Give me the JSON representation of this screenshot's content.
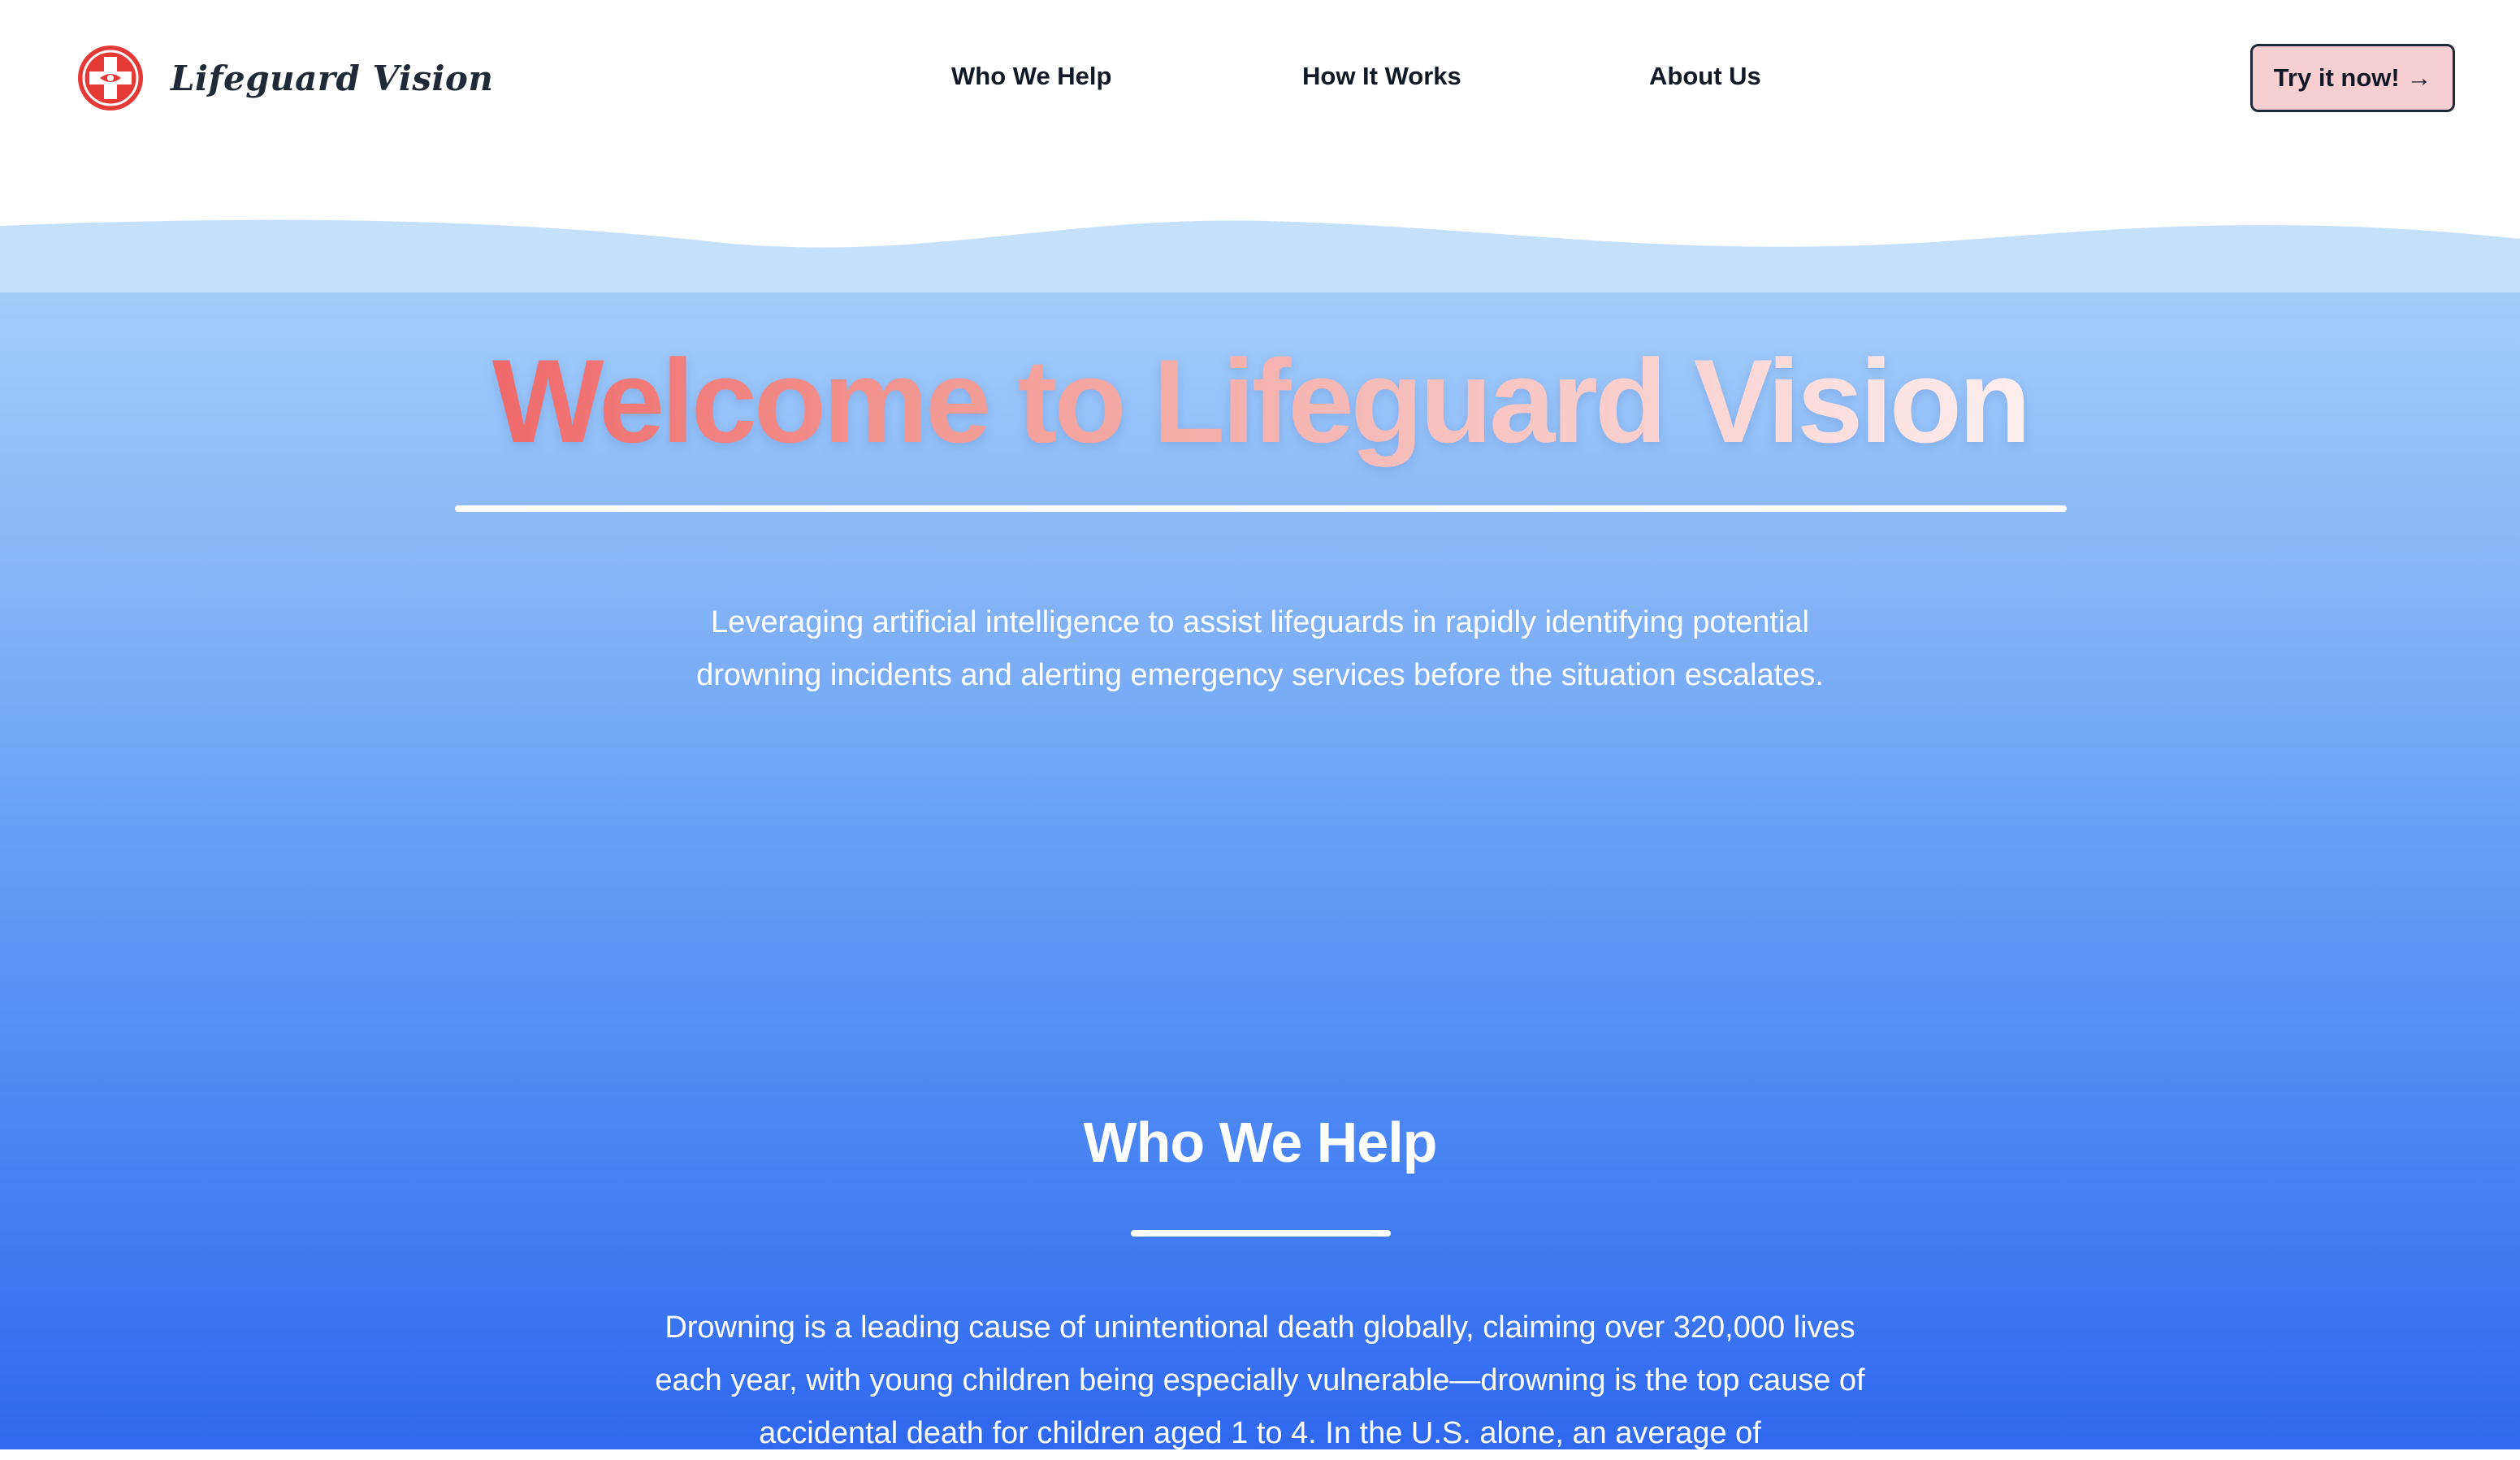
{
  "header": {
    "brand_name": "Lifeguard Vision",
    "nav": {
      "who_we_help": "Who We Help",
      "how_it_works": "How It Works",
      "about_us": "About Us"
    },
    "cta_label": "Try it now! →"
  },
  "hero": {
    "title": "Welcome to Lifeguard Vision",
    "subtitle": "Leveraging artificial intelligence to assist lifeguards in rapidly identifying potential drowning incidents and alerting emergency services before the situation escalates."
  },
  "who_we_help": {
    "title": "Who We Help",
    "body": "Drowning is a leading cause of unintentional death globally, claiming over 320,000 lives each year, with young children being especially vulnerable—drowning is the top cause of accidental death for children aged 1 to 4. In the U.S. alone, an average of"
  },
  "colors": {
    "logo_red": "#e53935",
    "cta_background": "#f8cfd0",
    "title_gradient_start": "#ef6b6b",
    "ocean_top": "#a3cdfa",
    "ocean_bottom": "#2f68ef"
  },
  "icons": {
    "logo": "lifeguard-cross-eye-icon"
  }
}
